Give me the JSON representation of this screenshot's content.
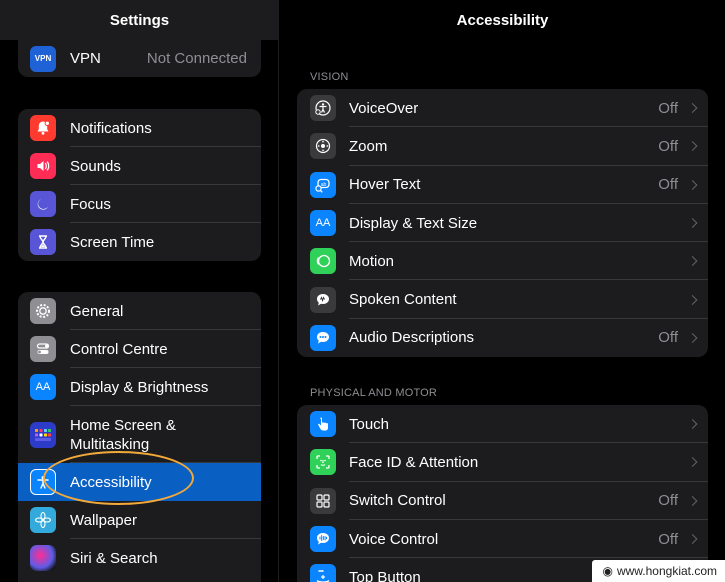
{
  "sidebar": {
    "title": "Settings",
    "group0": [
      {
        "label": "VPN",
        "value": "Not Connected",
        "icon": "vpn-icon",
        "color": "#1e62d6",
        "glyph": "VPN"
      }
    ],
    "group1": [
      {
        "label": "Notifications",
        "icon": "bell-icon",
        "color": "#ff3b30"
      },
      {
        "label": "Sounds",
        "icon": "speaker-icon",
        "color": "#ff2d55"
      },
      {
        "label": "Focus",
        "icon": "moon-icon",
        "color": "#5856d6"
      },
      {
        "label": "Screen Time",
        "icon": "hourglass-icon",
        "color": "#5856d6"
      }
    ],
    "group2": [
      {
        "label": "General",
        "icon": "gear-icon",
        "color": "#8e8e93"
      },
      {
        "label": "Control Centre",
        "icon": "toggles-icon",
        "color": "#8e8e93"
      },
      {
        "label": "Display & Brightness",
        "icon": "text-size-icon",
        "color": "#0a84ff",
        "glyph": "AA"
      },
      {
        "label": "Home Screen & Multitasking",
        "icon": "home-grid-icon",
        "color": "#2c3cc8"
      },
      {
        "label": "Accessibility",
        "icon": "accessibility-icon",
        "color": "#0a84ff",
        "selected": true
      },
      {
        "label": "Wallpaper",
        "icon": "flower-icon",
        "color": "#34aadc"
      },
      {
        "label": "Siri & Search",
        "icon": "siri-icon",
        "color": "#222"
      }
    ]
  },
  "main": {
    "title": "Accessibility",
    "sections": [
      {
        "label": "VISION",
        "items": [
          {
            "label": "VoiceOver",
            "value": "Off",
            "icon": "voiceover-icon",
            "color": "#3a3a3c"
          },
          {
            "label": "Zoom",
            "value": "Off",
            "icon": "zoom-icon",
            "color": "#3a3a3c"
          },
          {
            "label": "Hover Text",
            "value": "Off",
            "icon": "hover-text-icon",
            "color": "#0a84ff"
          },
          {
            "label": "Display & Text Size",
            "value": "",
            "icon": "text-size-icon",
            "color": "#0a84ff",
            "glyph": "AA"
          },
          {
            "label": "Motion",
            "value": "",
            "icon": "motion-icon",
            "color": "#30d158"
          },
          {
            "label": "Spoken Content",
            "value": "",
            "icon": "speech-bubble-icon",
            "color": "#3a3a3c"
          },
          {
            "label": "Audio Descriptions",
            "value": "Off",
            "icon": "audio-description-icon",
            "color": "#0a84ff"
          }
        ]
      },
      {
        "label": "PHYSICAL AND MOTOR",
        "items": [
          {
            "label": "Touch",
            "value": "",
            "icon": "hand-pointer-icon",
            "color": "#0a84ff"
          },
          {
            "label": "Face ID & Attention",
            "value": "",
            "icon": "face-id-icon",
            "color": "#30d158"
          },
          {
            "label": "Switch Control",
            "value": "Off",
            "icon": "switch-grid-icon",
            "color": "#3a3a3c"
          },
          {
            "label": "Voice Control",
            "value": "Off",
            "icon": "voice-control-icon",
            "color": "#0a84ff"
          },
          {
            "label": "Top Button",
            "value": "",
            "icon": "top-button-icon",
            "color": "#0a84ff"
          }
        ]
      }
    ]
  },
  "watermark": {
    "text": "www.hongkiat.com",
    "icon": "globe-icon"
  }
}
